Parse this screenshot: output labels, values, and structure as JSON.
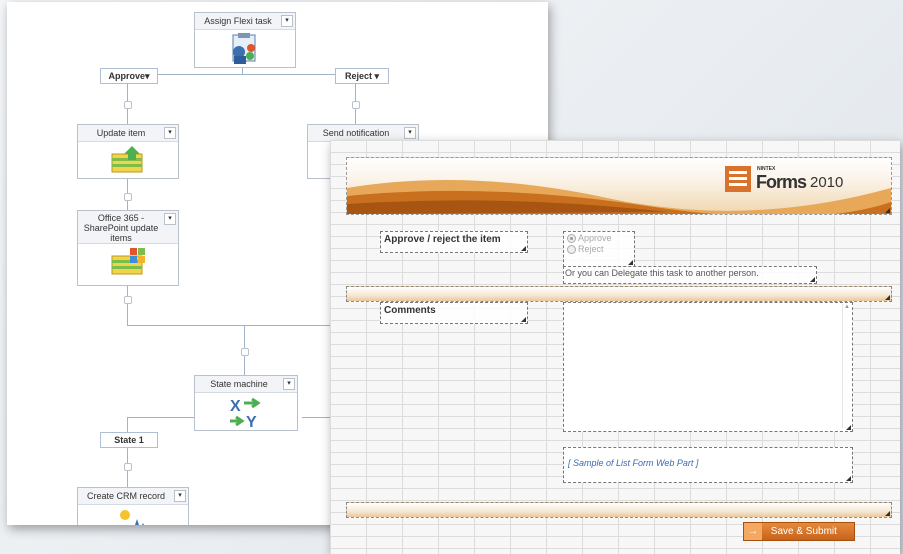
{
  "workflow": {
    "nodes": {
      "assign": "Assign Flexi task",
      "update": "Update item",
      "sendnotif": "Send notification",
      "o365": "Office 365 - SharePoint update items",
      "state_machine": "State machine",
      "crm": "Create CRM record"
    },
    "branches": {
      "approve": "Approve",
      "reject": "Reject",
      "state1": "State 1"
    },
    "dropdown_glyph": "▾"
  },
  "form": {
    "brand_small": "NINTEX",
    "brand": "Forms",
    "brand_year": "2010",
    "approve_label": "Approve / reject the item",
    "options": [
      "Approve",
      "Reject"
    ],
    "selected_option": "Approve",
    "delegate_text": "Or you can Delegate this task to another person.",
    "comments_label": "Comments",
    "list_form_text": "[ Sample of List Form Web Part ]",
    "submit_label": "Save & Submit",
    "submit_arrow": "→"
  },
  "colors": {
    "accent_orange": "#d9722a",
    "connector_blue": "#9fb2c8",
    "grid_line": "#dcdcdc"
  }
}
